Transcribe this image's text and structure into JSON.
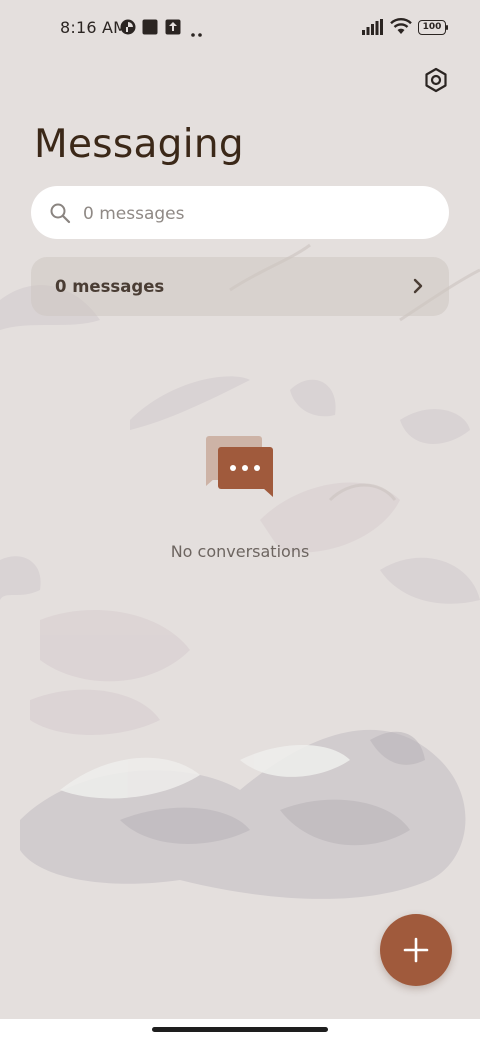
{
  "status_bar": {
    "time": "8:16 AM",
    "battery_level": "100",
    "left_icons": [
      "vpn-key-icon",
      "square-notification-icon",
      "upload-notification-icon",
      "more-dots-icon"
    ],
    "right_icons": [
      "signal-bars-icon",
      "wifi-icon",
      "battery-icon"
    ]
  },
  "header": {
    "title": "Messaging",
    "settings_icon": "settings-icon"
  },
  "search": {
    "placeholder": "0 messages",
    "value": "",
    "icon": "search-icon"
  },
  "messages_card": {
    "label": "0 messages",
    "icon": "chevron-right-icon"
  },
  "empty_state": {
    "icon": "chat-bubbles-icon",
    "text": "No conversations"
  },
  "fab": {
    "icon": "plus-icon"
  },
  "colors": {
    "background": "#e4dfdd",
    "accent": "#a05a3c",
    "title": "#3b2818"
  }
}
